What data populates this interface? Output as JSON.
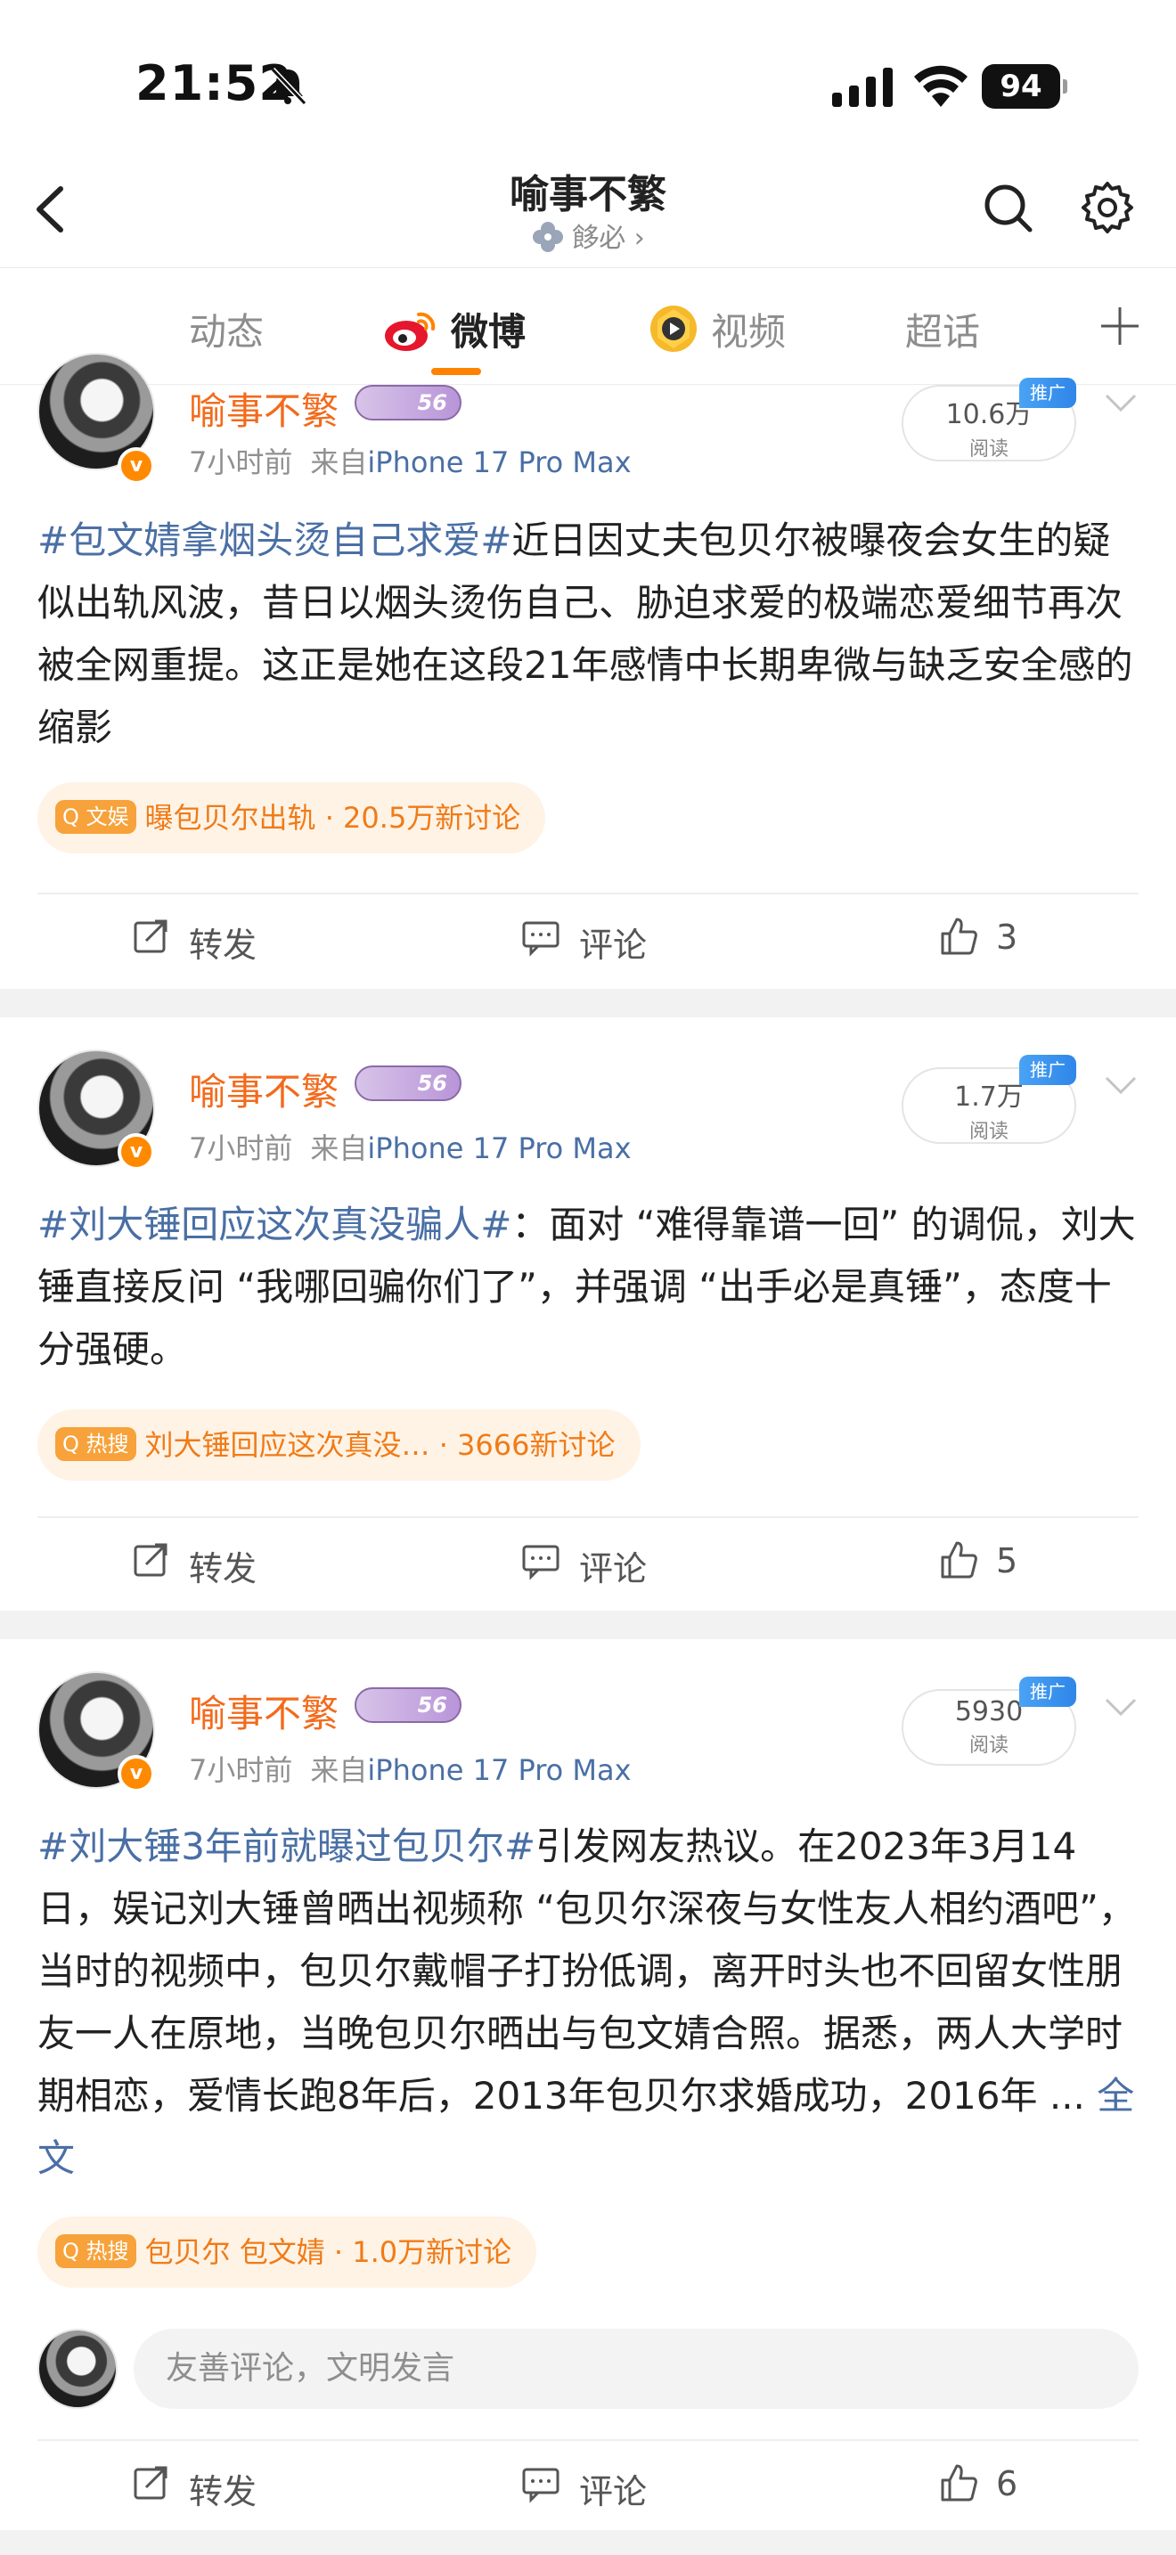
{
  "status": {
    "time": "21:52",
    "battery": "94"
  },
  "header": {
    "title": "喻事不繁",
    "subtitle": "䬷必 ›"
  },
  "tabs": [
    {
      "label": "动态"
    },
    {
      "label": "微博"
    },
    {
      "label": "视频"
    },
    {
      "label": "超话"
    }
  ],
  "posts": [
    {
      "username": "喻事不繁",
      "level": "56",
      "time": "7小时前",
      "source_prefix": "来自",
      "device": "iPhone 17 Pro Max",
      "views_num": "10.6万",
      "views_label": "阅读",
      "promo": "推广",
      "hashtag": "#包文婧拿烟头烫自己求爱#",
      "text": "近日因丈夫包贝尔被曝夜会女生的疑似出轨风波，昔日以烟头烫伤自己、胁迫求爱的极端恋爱细节再次被全网重提。这正是她在这段21年感情中长期卑微与缺乏安全感的缩影",
      "pill_badge": "文娱",
      "pill_text": "曝包贝尔出轨 · 20.5万新讨论",
      "repost": "转发",
      "comment": "评论",
      "likes": "3"
    },
    {
      "username": "喻事不繁",
      "level": "56",
      "time": "7小时前",
      "source_prefix": "来自",
      "device": "iPhone 17 Pro Max",
      "views_num": "1.7万",
      "views_label": "阅读",
      "promo": "推广",
      "hashtag": "#刘大锤回应这次真没骗人#",
      "text": "：面对 “难得靠谱一回” 的调侃，刘大锤直接反问 “我哪回骗你们了”，并强调 “出手必是真锤”，态度十分强硬。",
      "pill_badge": "热搜",
      "pill_text": "刘大锤回应这次真没… · 3666新讨论",
      "repost": "转发",
      "comment": "评论",
      "likes": "5"
    },
    {
      "username": "喻事不繁",
      "level": "56",
      "time": "7小时前",
      "source_prefix": "来自",
      "device": "iPhone 17 Pro Max",
      "views_num": "5930",
      "views_label": "阅读",
      "promo": "推广",
      "hashtag": "#刘大锤3年前就曝过包贝尔#",
      "text": "引发网友热议。在2023年3月14日，娱记刘大锤曾晒出视频称 “包贝尔深夜与女性友人相约酒吧”，当时的视频中，包贝尔戴帽子打扮低调，离开时头也不回留女性朋友一人在原地，当晚包贝尔晒出与包文婧合照。据悉，两人大学时期相恋，爱情长跑8年后，2013年包贝尔求婚成功，2016年 ... ",
      "more": "全文",
      "pill_badge": "热搜",
      "pill_text": "包贝尔 包文婧 · 1.0万新讨论",
      "comment_placeholder": "友善评论，文明发言",
      "repost": "转发",
      "comment": "评论",
      "likes": "6"
    }
  ]
}
